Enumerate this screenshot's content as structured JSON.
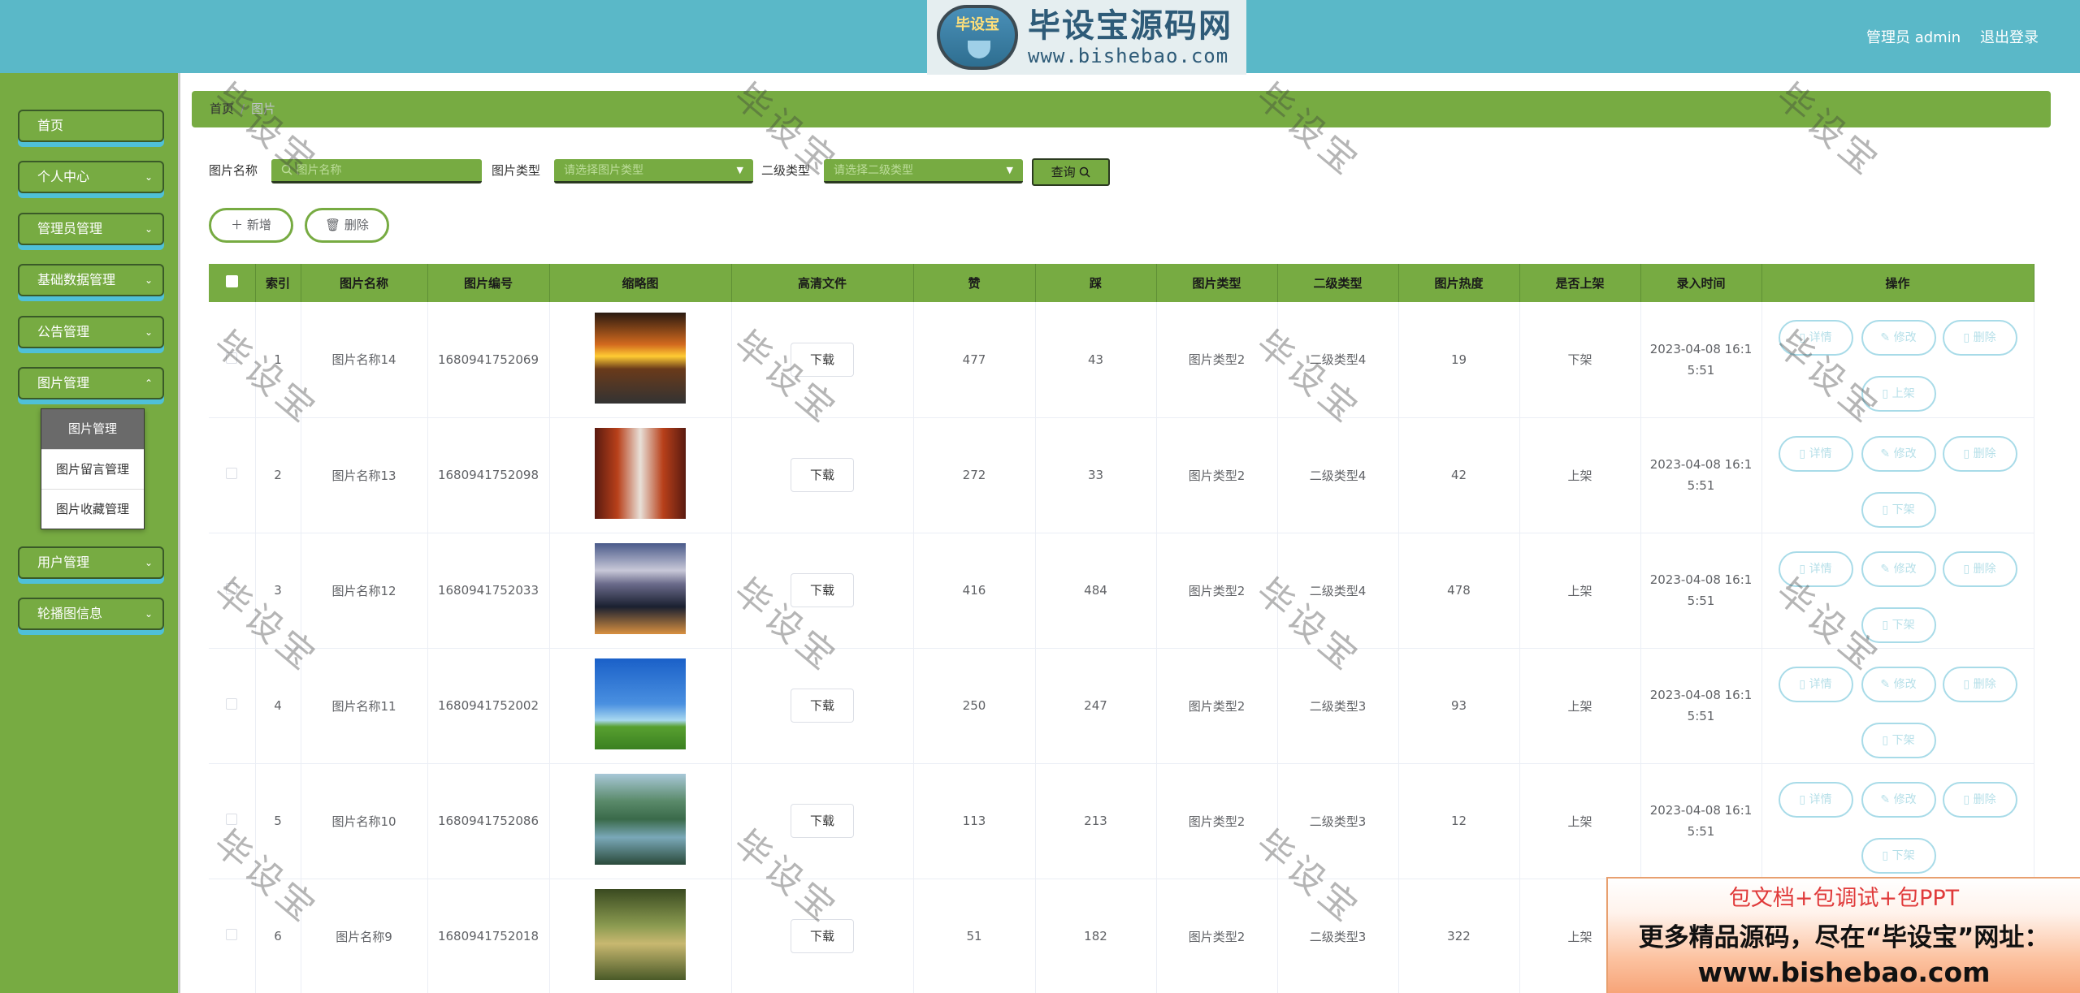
{
  "header": {
    "logo_badge": "毕设宝",
    "logo_title": "毕设宝源码网",
    "logo_url": "www.bishebao.com",
    "admin_label": "管理员 admin",
    "logout_label": "退出登录"
  },
  "sidebar": {
    "items": [
      {
        "label": "首页",
        "chevron": ""
      },
      {
        "label": "个人中心",
        "chevron": "⌄"
      },
      {
        "label": "管理员管理",
        "chevron": "⌄"
      },
      {
        "label": "基础数据管理",
        "chevron": "⌄"
      },
      {
        "label": "公告管理",
        "chevron": "⌄"
      },
      {
        "label": "图片管理",
        "chevron": "⌃"
      },
      {
        "label": "用户管理",
        "chevron": "⌄"
      },
      {
        "label": "轮播图信息",
        "chevron": "⌄"
      }
    ],
    "submenu": [
      "图片管理",
      "图片留言管理",
      "图片收藏管理"
    ]
  },
  "breadcrumb": {
    "home": "首页",
    "sep": "/",
    "current": "图片"
  },
  "search": {
    "name_label": "图片名称",
    "name_placeholder": "图片名称",
    "type_label": "图片类型",
    "type_placeholder": "请选择图片类型",
    "subtype_label": "二级类型",
    "subtype_placeholder": "请选择二级类型",
    "query_label": "查询"
  },
  "actions": {
    "add": "新增",
    "delete": "删除"
  },
  "table": {
    "headers": [
      "",
      "索引",
      "图片名称",
      "图片编号",
      "缩略图",
      "高清文件",
      "赞",
      "踩",
      "图片类型",
      "二级类型",
      "图片热度",
      "是否上架",
      "录入时间",
      "操作"
    ],
    "download_label": "下载",
    "op_labels": {
      "detail": "详情",
      "edit": "修改",
      "delete": "删除",
      "on": "上架",
      "off": "下架"
    },
    "rows": [
      {
        "index": "1",
        "name": "图片名称14",
        "code": "1680941752069",
        "like": "477",
        "dislike": "43",
        "type": "图片类型2",
        "subtype": "二级类型4",
        "heat": "19",
        "status": "下架",
        "time": "2023-04-08 16:15:51",
        "toggle": "上架",
        "thumb": "sunset"
      },
      {
        "index": "2",
        "name": "图片名称13",
        "code": "1680941752098",
        "like": "272",
        "dislike": "33",
        "type": "图片类型2",
        "subtype": "二级类型4",
        "heat": "42",
        "status": "上架",
        "time": "2023-04-08 16:15:51",
        "toggle": "下架",
        "thumb": "corridor"
      },
      {
        "index": "3",
        "name": "图片名称12",
        "code": "1680941752033",
        "like": "416",
        "dislike": "484",
        "type": "图片类型2",
        "subtype": "二级类型4",
        "heat": "478",
        "status": "上架",
        "time": "2023-04-08 16:15:51",
        "toggle": "下架",
        "thumb": "mountain-city"
      },
      {
        "index": "4",
        "name": "图片名称11",
        "code": "1680941752002",
        "like": "250",
        "dislike": "247",
        "type": "图片类型2",
        "subtype": "二级类型3",
        "heat": "93",
        "status": "上架",
        "time": "2023-04-08 16:15:51",
        "toggle": "下架",
        "thumb": "sky-field"
      },
      {
        "index": "5",
        "name": "图片名称10",
        "code": "1680941752086",
        "like": "113",
        "dislike": "213",
        "type": "图片类型2",
        "subtype": "二级类型3",
        "heat": "12",
        "status": "上架",
        "time": "2023-04-08 16:15:51",
        "toggle": "下架",
        "thumb": "lake-hills"
      },
      {
        "index": "6",
        "name": "图片名称9",
        "code": "1680941752018",
        "like": "51",
        "dislike": "182",
        "type": "图片类型2",
        "subtype": "二级类型3",
        "heat": "322",
        "status": "上架",
        "time": "",
        "toggle": "",
        "thumb": "forest-path"
      }
    ]
  },
  "watermark": "毕设宝",
  "promo": {
    "line1": "包文档+包调试+包PPT",
    "line2": "更多精品源码，尽在“毕设宝”网址：",
    "line3": "www.bishebao.com"
  },
  "colors": {
    "header": "#5ab8c8",
    "green": "#77ab42",
    "op_border": "#a8dbe8"
  }
}
